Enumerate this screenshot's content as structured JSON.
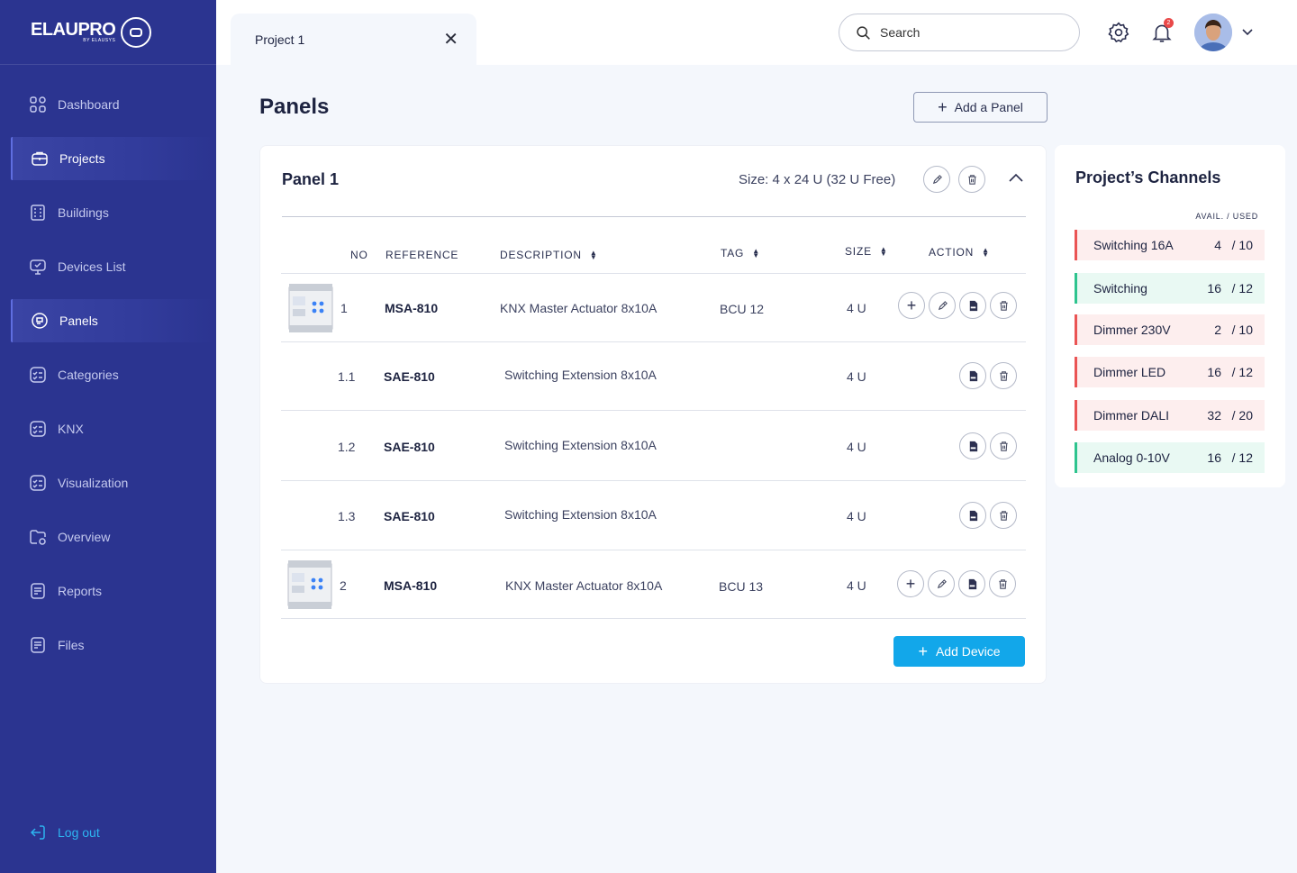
{
  "brand": {
    "name": "ELAUPRO",
    "sub": "BY ELAUSYS"
  },
  "sidebar": {
    "items": [
      {
        "label": "Dashboard",
        "icon": "dashboard-icon",
        "active": false
      },
      {
        "label": "Projects",
        "icon": "briefcase-icon",
        "active": true
      },
      {
        "label": "Buildings",
        "icon": "building-icon",
        "active": false
      },
      {
        "label": "Devices List",
        "icon": "devices-icon",
        "active": false
      },
      {
        "label": "Panels",
        "icon": "panel-icon",
        "active": true
      },
      {
        "label": "Categories",
        "icon": "categories-icon",
        "active": false
      },
      {
        "label": "KNX",
        "icon": "knx-icon",
        "active": false
      },
      {
        "label": "Visualization",
        "icon": "visualization-icon",
        "active": false
      },
      {
        "label": "Overview",
        "icon": "overview-icon",
        "active": false
      },
      {
        "label": "Reports",
        "icon": "reports-icon",
        "active": false
      },
      {
        "label": "Files",
        "icon": "files-icon",
        "active": false
      }
    ],
    "logout": "Log out"
  },
  "header": {
    "tab_label": "Project 1",
    "search_placeholder": "Search",
    "notification_count": "2"
  },
  "page": {
    "title": "Panels",
    "add_panel_label": "Add a Panel"
  },
  "panel": {
    "title": "Panel 1",
    "size": "Size: 4 x 24 U (32 U Free)",
    "columns": {
      "no": "NO",
      "reference": "REFERENCE",
      "description": "DESCRIPTION",
      "tag": "TAG",
      "size": "SIZE",
      "action": "ACTION"
    },
    "rows": [
      {
        "no": "1",
        "reference": "MSA-810",
        "description": "KNX Master Actuator 8x10A",
        "tag": "BCU 12",
        "size": "4 U"
      },
      {
        "no": "1.1",
        "reference": "SAE-810",
        "description": "Switching Extension 8x10A",
        "tag": "",
        "size": "4 U"
      },
      {
        "no": "1.2",
        "reference": "SAE-810",
        "description": "Switching Extension 8x10A",
        "tag": "",
        "size": "4 U"
      },
      {
        "no": "1.3",
        "reference": "SAE-810",
        "description": "Switching Extension 8x10A",
        "tag": "",
        "size": "4 U"
      },
      {
        "no": "2",
        "reference": "MSA-810",
        "description": "KNX Master Actuator 8x10A",
        "tag": "BCU 13",
        "size": "4 U"
      }
    ],
    "add_device_label": "Add Device"
  },
  "channels": {
    "title": "Project’s Channels",
    "header": "AVAIL. / USED",
    "items": [
      {
        "name": "Switching 16A",
        "avail": "4",
        "used": "/ 10",
        "status": "red"
      },
      {
        "name": "Switching",
        "avail": "16",
        "used": "/ 12",
        "status": "green"
      },
      {
        "name": "Dimmer 230V",
        "avail": "2",
        "used": "/ 10",
        "status": "red"
      },
      {
        "name": "Dimmer LED",
        "avail": "16",
        "used": "/ 12",
        "status": "red"
      },
      {
        "name": "Dimmer DALI",
        "avail": "32",
        "used": "/ 20",
        "status": "red"
      },
      {
        "name": "Analog 0-10V",
        "avail": "16",
        "used": "/ 12",
        "status": "green"
      }
    ]
  },
  "colors": {
    "sidebar_bg": "#2b3490",
    "accent": "#12a7ea",
    "red": "#ea5454",
    "green": "#2ec48e"
  }
}
